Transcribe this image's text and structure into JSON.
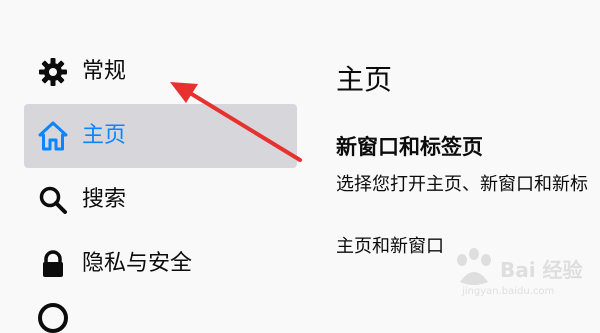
{
  "sidebar": {
    "items": [
      {
        "label": "常规",
        "icon": "gear-icon"
      },
      {
        "label": "主页",
        "icon": "home-icon",
        "selected": true
      },
      {
        "label": "搜索",
        "icon": "search-icon"
      },
      {
        "label": "隐私与安全",
        "icon": "lock-icon"
      }
    ]
  },
  "main": {
    "title": "主页",
    "section_title": "新窗口和标签页",
    "section_desc": "选择您打开主页、新窗口和新标",
    "sub_label": "主页和新窗口"
  },
  "annotation": {
    "arrow_color": "#e8312f"
  },
  "watermark": {
    "text": "Bai 经验",
    "url": "jingyan.baidu.com"
  },
  "colors": {
    "accent": "#0a84ff",
    "selected_bg": "#d7d7db",
    "page_bg": "#f9f9fa"
  }
}
